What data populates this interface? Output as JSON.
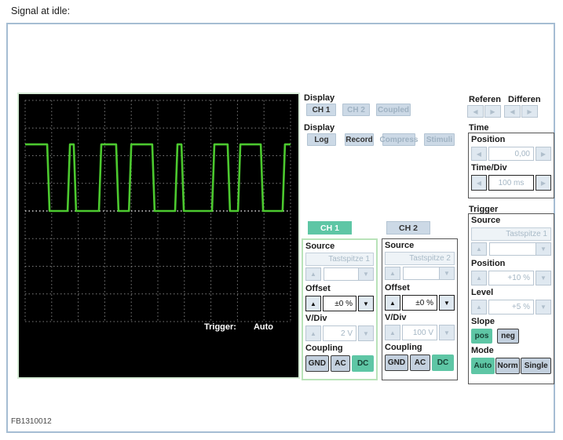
{
  "page": {
    "title": "Signal at idle:",
    "figure_code": "FB1310012"
  },
  "icons": {
    "up": "▲",
    "down": "▼",
    "left": "◀",
    "right": "▶"
  },
  "colors": {
    "outer_border": "#a5bdd3",
    "teal_active": "#5ec6a5",
    "button_bg": "#ccd9e6",
    "signal_green": "#4cc92f",
    "scope_bg": "#000000",
    "grid_line": "#7d7d7d",
    "grid_center_line": "#d8d8d8",
    "scope_border": "#d8eed8"
  },
  "scope": {
    "status_label": "Trigger:",
    "status_value": "Auto",
    "chart_data": {
      "type": "line",
      "title": "Oscilloscope trace - square-wave signal at idle",
      "x_axis": {
        "divisions": 10,
        "time_per_div": "100 ms"
      },
      "y_axis": {
        "divisions": 8,
        "volts_per_div": "2 V"
      },
      "levels": {
        "high_frac": 0.199,
        "low_frac": 0.5
      },
      "high_segments_frac": [
        [
          0.0,
          0.083
        ],
        [
          0.16,
          0.183
        ],
        [
          0.278,
          0.343
        ],
        [
          0.391,
          0.479
        ],
        [
          0.565,
          0.589
        ],
        [
          0.704,
          0.763
        ],
        [
          0.802,
          0.888
        ],
        [
          0.97,
          1.0
        ]
      ]
    }
  },
  "display_channels": {
    "label": "Display",
    "buttons": [
      {
        "label": "CH 1",
        "enabled": true
      },
      {
        "label": "CH 2",
        "enabled": false
      },
      {
        "label": "Coupled",
        "enabled": false
      }
    ]
  },
  "display_modes": {
    "label": "Display",
    "buttons": [
      {
        "label": "Log",
        "enabled": true
      },
      {
        "label": "Record",
        "enabled": true
      },
      {
        "label": "Compress",
        "enabled": false
      },
      {
        "label": "Stimuli",
        "enabled": false
      }
    ]
  },
  "reference": {
    "label": "Referen"
  },
  "difference": {
    "label": "Differen"
  },
  "time": {
    "label": "Time",
    "position": {
      "label": "Position",
      "value": "0,00"
    },
    "time_div": {
      "label": "Time/Div",
      "value": "100 ms"
    }
  },
  "channel1": {
    "button_label": "CH 1",
    "source": {
      "label": "Source",
      "value": "Tastspitze 1"
    },
    "offset": {
      "label": "Offset",
      "value": "±0 %"
    },
    "v_div": {
      "label": "V/Div",
      "value": "2 V"
    },
    "coupling": {
      "label": "Coupling",
      "buttons": [
        {
          "label": "GND",
          "active": false
        },
        {
          "label": "AC",
          "active": false
        },
        {
          "label": "DC",
          "active": true
        }
      ]
    }
  },
  "channel2": {
    "button_label": "CH 2",
    "source": {
      "label": "Source",
      "value": "Tastspitze 2"
    },
    "offset": {
      "label": "Offset",
      "value": "±0 %"
    },
    "v_div": {
      "label": "V/Div",
      "value": "100 V"
    },
    "coupling": {
      "label": "Coupling",
      "buttons": [
        {
          "label": "GND",
          "active": false
        },
        {
          "label": "AC",
          "active": false
        },
        {
          "label": "DC",
          "active": true
        }
      ]
    }
  },
  "trigger": {
    "label": "Trigger",
    "source": {
      "label": "Source",
      "value": "Tastspitze 1"
    },
    "position": {
      "label": "Position",
      "value": "+10 %"
    },
    "level": {
      "label": "Level",
      "value": "+5 %"
    },
    "slope": {
      "label": "Slope",
      "buttons": [
        {
          "label": "pos",
          "active": true
        },
        {
          "label": "neg",
          "active": false
        }
      ]
    },
    "mode": {
      "label": "Mode",
      "buttons": [
        {
          "label": "Auto",
          "active": true
        },
        {
          "label": "Norm",
          "active": false
        },
        {
          "label": "Single",
          "active": false
        }
      ]
    }
  }
}
